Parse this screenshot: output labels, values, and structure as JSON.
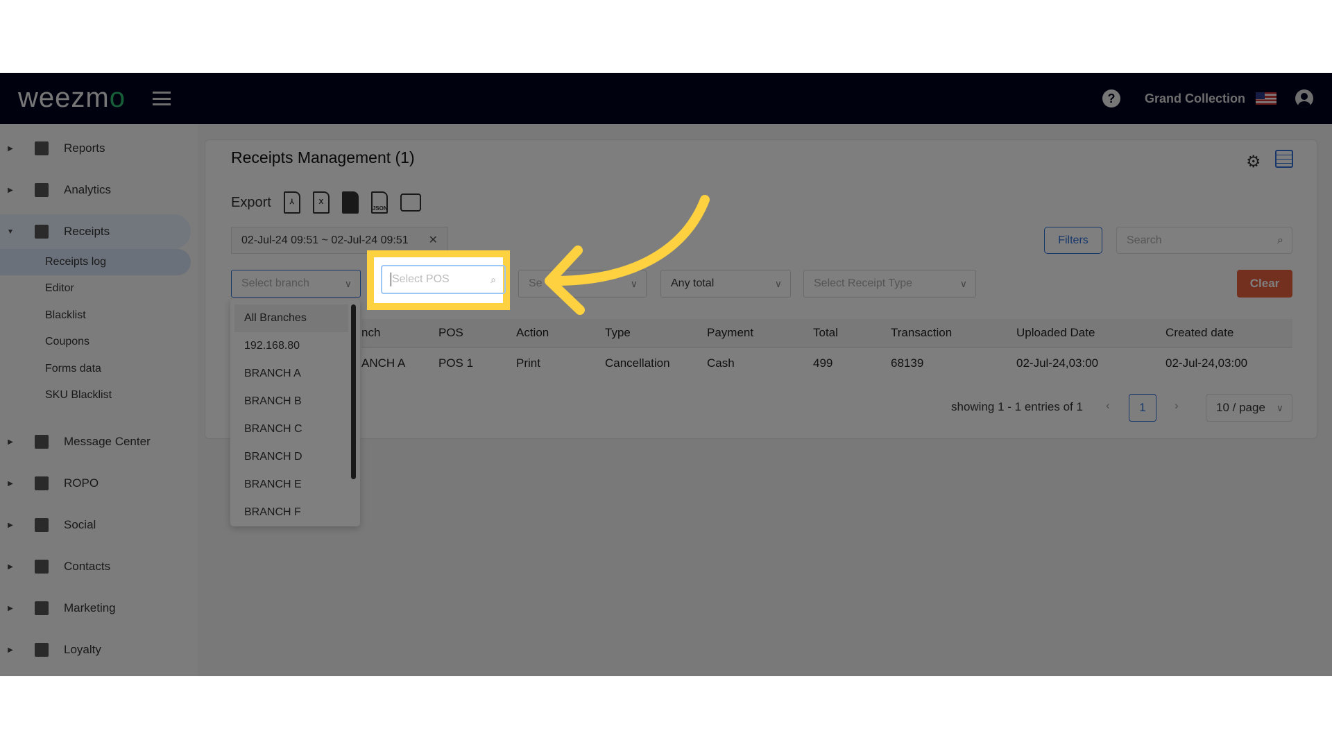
{
  "header": {
    "logo": "weezmo",
    "org_name": "Grand Collection",
    "help": "?"
  },
  "sidebar": {
    "items": [
      {
        "label": "Reports",
        "icon": "dashboard-icon"
      },
      {
        "label": "Analytics",
        "icon": "chart-icon"
      },
      {
        "label": "Receipts",
        "icon": "receipt-icon",
        "expanded": true
      },
      {
        "label": "Message Center",
        "icon": "message-icon"
      },
      {
        "label": "ROPO",
        "icon": "infinity-icon"
      },
      {
        "label": "Social",
        "icon": "people-icon"
      },
      {
        "label": "Contacts",
        "icon": "contacts-icon"
      },
      {
        "label": "Marketing",
        "icon": "megaphone-icon"
      },
      {
        "label": "Loyalty",
        "icon": "tag-icon"
      }
    ],
    "sub_items": [
      "Receipts log",
      "Editor",
      "Blacklist",
      "Coupons",
      "Forms data",
      "SKU Blacklist"
    ]
  },
  "main": {
    "title": "Receipts Management (1)",
    "export_label": "Export",
    "export_formats": [
      "PDF",
      "X",
      "DOC",
      "JSON",
      "Print"
    ],
    "date_range": "02-Jul-24 09:51 ~ 02-Jul-24 09:51",
    "filters_label": "Filters",
    "search_placeholder": "Search",
    "branch_placeholder": "Select branch",
    "pos_placeholder": "Select POS",
    "third_placeholder": "Se",
    "total_value": "Any total",
    "receipt_type_placeholder": "Select Receipt Type",
    "clear_label": "Clear",
    "columns": [
      "nch",
      "POS",
      "Action",
      "Type",
      "Payment",
      "Total",
      "Transaction",
      "Uploaded Date",
      "Created date"
    ],
    "rows": [
      [
        "ANCH A",
        "POS 1",
        "Print",
        "Cancellation",
        "Cash",
        "499",
        "68139",
        "02-Jul-24,03:00",
        "02-Jul-24,03:00"
      ]
    ],
    "pagination": {
      "summary": "showing 1 - 1 entries of 1",
      "current_page": "1",
      "page_size": "10 / page"
    },
    "branch_options": [
      "All Branches",
      "192.168.80",
      "BRANCH A",
      "BRANCH B",
      "BRANCH C",
      "BRANCH D",
      "BRANCH E",
      "BRANCH F"
    ]
  },
  "colors": {
    "header": "#00021f",
    "accent": "#2f6fd6",
    "clear": "#e8603f",
    "highlight": "#fdd13f"
  }
}
